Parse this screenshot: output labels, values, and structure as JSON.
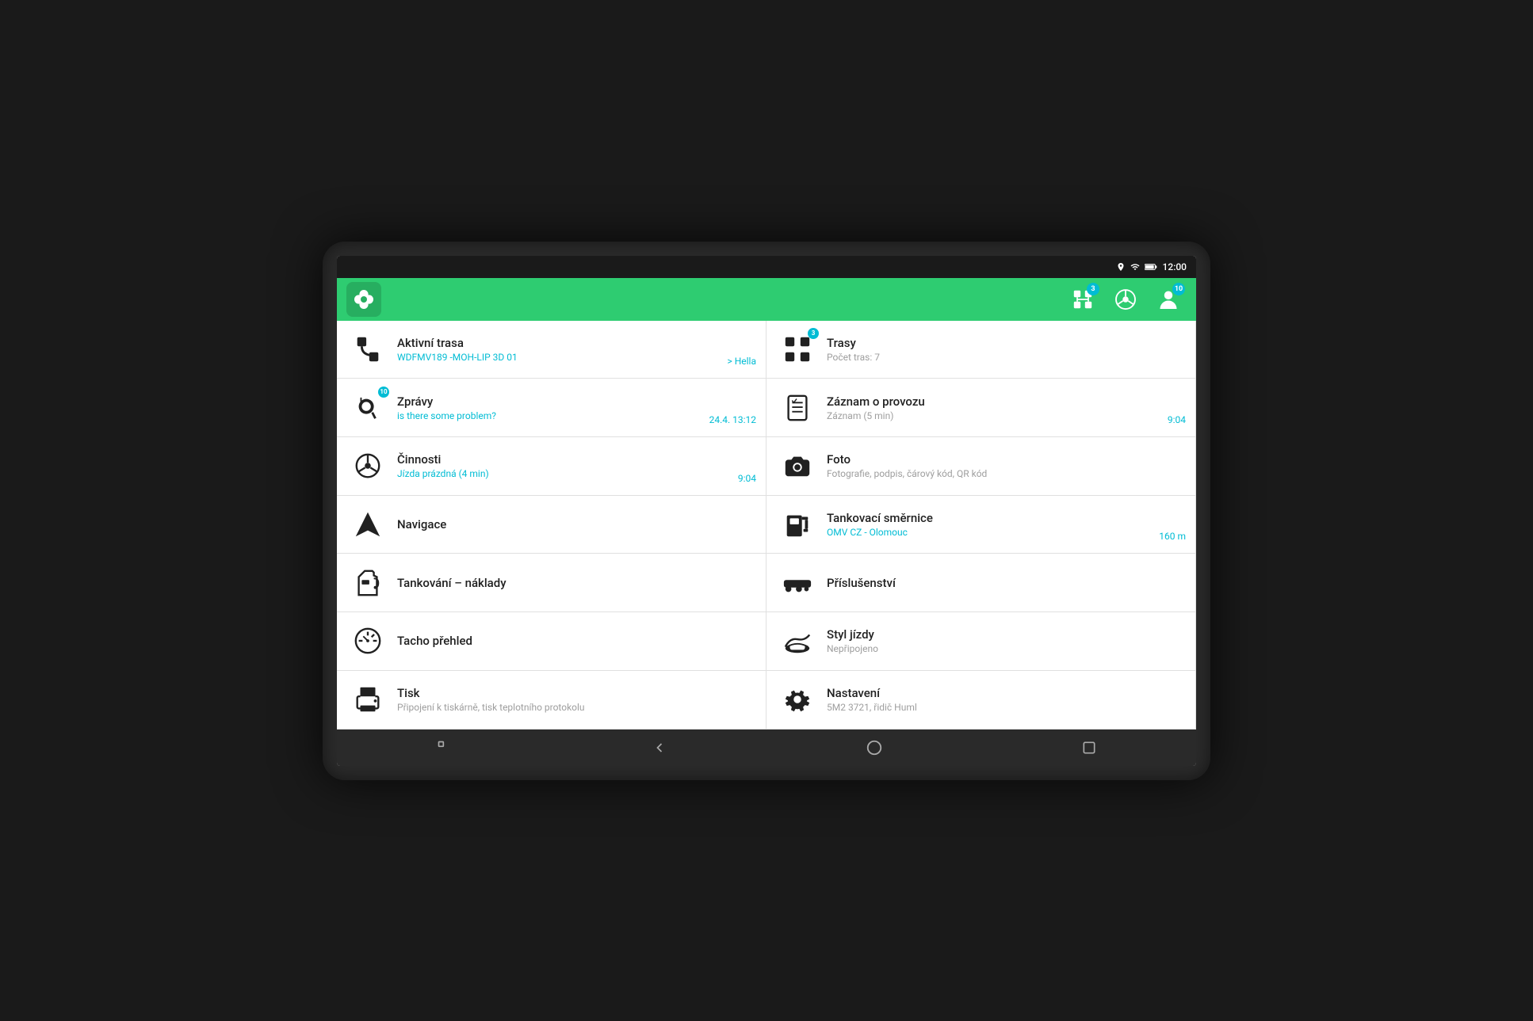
{
  "status_bar": {
    "time": "12:00"
  },
  "header": {
    "badge_routes": "3",
    "badge_user": "10"
  },
  "menu_items": [
    {
      "id": "aktivni-trasa",
      "title": "Aktivní trasa",
      "subtitle": "WDFMV189 -MOH-LIP 3D 01",
      "time": "> Hella",
      "icon": "route",
      "badge": null
    },
    {
      "id": "trasy",
      "title": "Trasy",
      "subtitle": "Počet tras: 7",
      "time": null,
      "icon": "routes",
      "badge": "3"
    },
    {
      "id": "zpravy",
      "title": "Zprávy",
      "subtitle": "is there some problem?",
      "time": "24.4. 13:12",
      "icon": "messages",
      "badge": "10"
    },
    {
      "id": "zaznam-provozu",
      "title": "Záznam o provozu",
      "subtitle": "Záznam (5 min)",
      "time": "9:04",
      "icon": "log",
      "badge": null
    },
    {
      "id": "cinnosti",
      "title": "Činnosti",
      "subtitle": "Jízda prázdná (4 min)",
      "time": "9:04",
      "icon": "steering",
      "badge": null
    },
    {
      "id": "foto",
      "title": "Foto",
      "subtitle": "Fotografie, podpis, čárový kód, QR kód",
      "time": null,
      "icon": "camera",
      "badge": null
    },
    {
      "id": "navigace",
      "title": "Navigace",
      "subtitle": null,
      "time": null,
      "icon": "navigation",
      "badge": null
    },
    {
      "id": "tankovaci-smernice",
      "title": "Tankovací směrnice",
      "subtitle": "OMV CZ - Olomouc",
      "time": "160 m",
      "icon": "fuel-station",
      "badge": null
    },
    {
      "id": "tankovani-naklady",
      "title": "Tankování – náklady",
      "subtitle": null,
      "time": null,
      "icon": "fuel",
      "badge": null
    },
    {
      "id": "prislusenstvi",
      "title": "Příslušenství",
      "subtitle": null,
      "time": null,
      "icon": "accessories",
      "badge": null
    },
    {
      "id": "tacho-prehled",
      "title": "Tacho přehled",
      "subtitle": null,
      "time": null,
      "icon": "tacho",
      "badge": null
    },
    {
      "id": "styl-jizdy",
      "title": "Styl jízdy",
      "subtitle": "Nepřipojeno",
      "time": null,
      "icon": "driving-style",
      "badge": null
    },
    {
      "id": "tisk",
      "title": "Tisk",
      "subtitle": "Připojení k tiskárně, tisk teplotního protokolu",
      "time": null,
      "icon": "print",
      "badge": null
    },
    {
      "id": "nastaveni",
      "title": "Nastavení",
      "subtitle": "5M2 3721, řidič Huml",
      "time": null,
      "icon": "settings",
      "badge": null
    }
  ],
  "bottom_nav": {
    "back": "◁",
    "home": "○",
    "recents": "□"
  }
}
